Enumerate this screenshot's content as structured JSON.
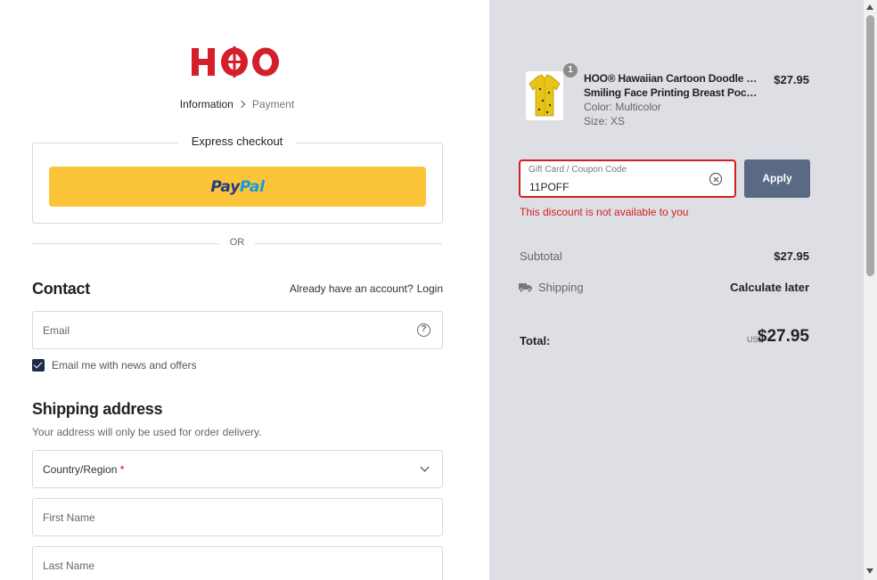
{
  "brand": {
    "logo_text": "HOO",
    "logo_color": "#d41f2a"
  },
  "breadcrumb": {
    "current": "Information",
    "next": "Payment"
  },
  "express_checkout": {
    "title": "Express checkout",
    "paypal_part1": "Pay",
    "paypal_part2": "Pal",
    "paypal_color": "#fcc439"
  },
  "divider": {
    "or_text": "OR"
  },
  "contact": {
    "title": "Contact",
    "account_prompt": "Already have an account?",
    "login_label": "Login",
    "email_placeholder": "Email",
    "newsletter_label": "Email me with news and offers",
    "newsletter_checked": true
  },
  "shipping": {
    "title": "Shipping address",
    "note": "Your address will only be used for order delivery.",
    "country_label": "Country/Region",
    "required_mark": "*",
    "first_name_placeholder": "First Name",
    "last_name_placeholder": "Last Name"
  },
  "cart": {
    "quantity": "1",
    "product_line1": "HOO® Hawaiian Cartoon Doodle Cute",
    "product_line2": "Smiling Face Printing Breast Pocket…",
    "color": "Color: Multicolor",
    "size": "Size: XS",
    "price": "$27.95"
  },
  "coupon": {
    "label": "Gift Card / Coupon Code",
    "value": "11POFF",
    "apply_label": "Apply",
    "error": "This discount is not available to you",
    "error_color": "#d41f1f"
  },
  "summary": {
    "subtotal_label": "Subtotal",
    "subtotal_value": "$27.95",
    "shipping_label": "Shipping",
    "shipping_value": "Calculate later",
    "total_label": "Total:",
    "currency": "USD",
    "total_value": "$27.95"
  }
}
